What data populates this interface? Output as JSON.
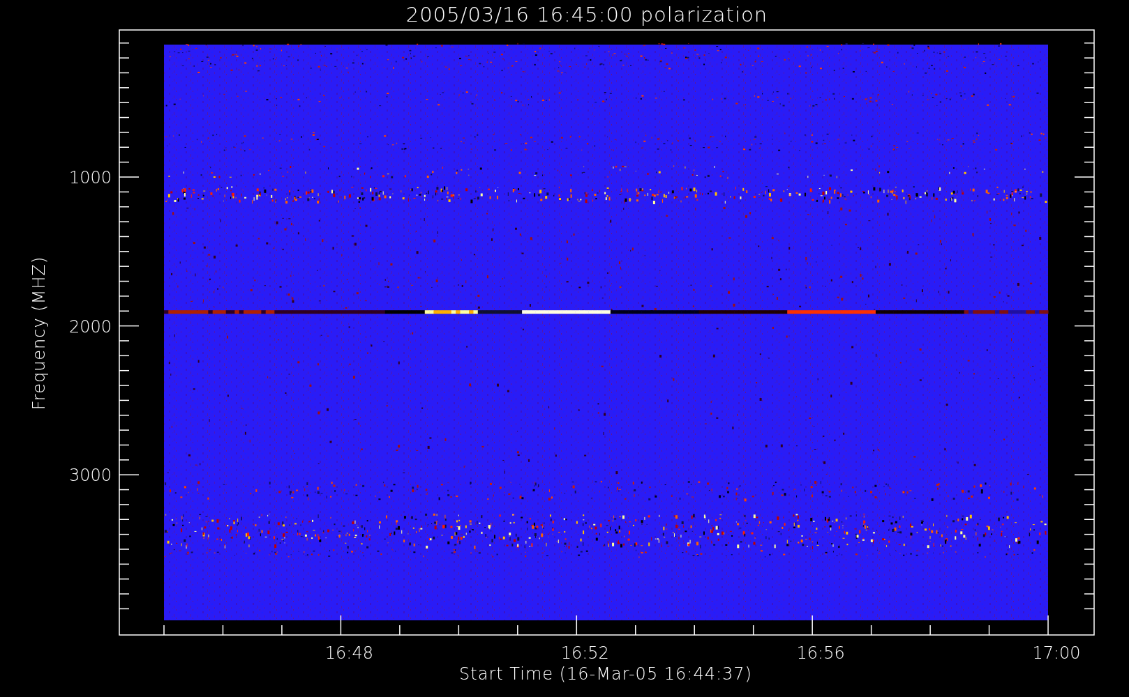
{
  "plot": {
    "title": "2005/03/16 16:45:00 polarization",
    "ylabel": "Frequency (MHZ)",
    "xlabel": "Start Time (16-Mar-05 16:44:37)",
    "y_tick_labels": [
      "1000",
      "2000",
      "3000"
    ],
    "x_tick_labels": [
      "16:48",
      "16:52",
      "16:56",
      "17:00"
    ]
  }
}
